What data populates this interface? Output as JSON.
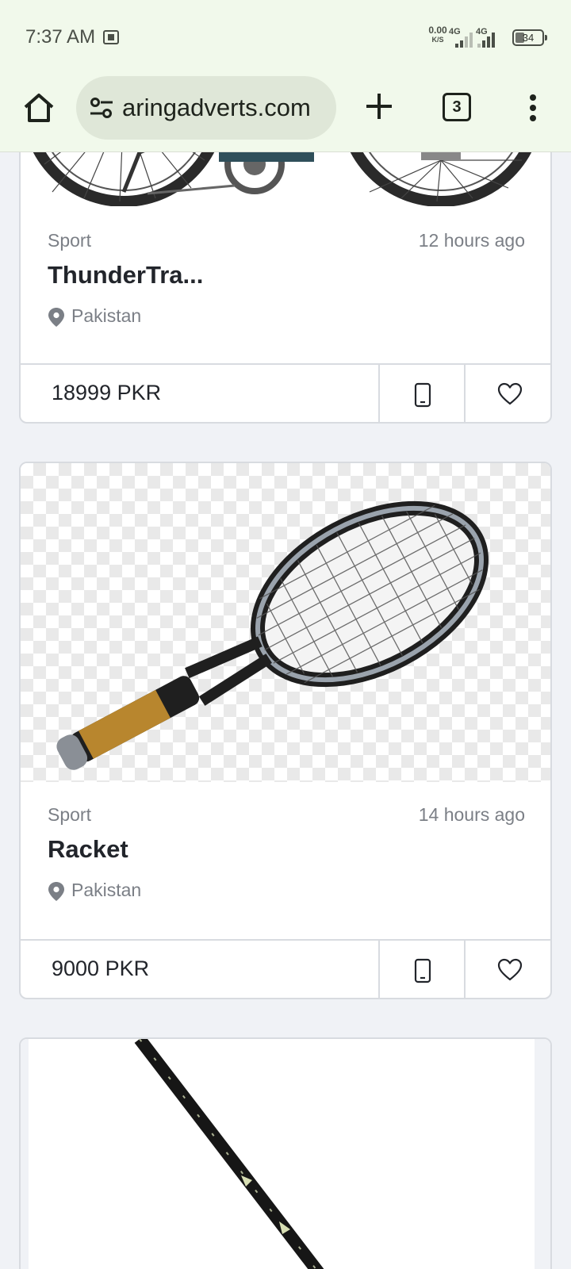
{
  "status_bar": {
    "time": "7:37 AM",
    "net_speed_value": "0.00",
    "net_speed_unit": "K/S",
    "sim1_label": "4G",
    "sim2_label": "4G",
    "battery_level": "34"
  },
  "browser": {
    "url": "aringadverts.com",
    "tab_count": "3",
    "icons": [
      "home-icon",
      "tune-icon",
      "plus-icon",
      "tabs-icon",
      "more-vert-icon"
    ]
  },
  "listings": [
    {
      "category": "Sport",
      "posted": "12 hours ago",
      "title": "ThunderTra...",
      "location": "Pakistan",
      "price": "18999 PKR",
      "image": "mountain bicycle (partially scrolled out of view)"
    },
    {
      "category": "Sport",
      "posted": "14 hours ago",
      "title": "Racket",
      "location": "Pakistan",
      "price": "9000 PKR",
      "image": "tennis racket on transparent checkerboard background"
    },
    {
      "image": "racket shaft close-up (partially visible)"
    }
  ],
  "colors": {
    "chrome_bg": "#f1f9eb",
    "url_pill_bg": "#dfe7d8",
    "page_bg": "#f0f2f6",
    "card_border": "#d8dbe0",
    "muted_text": "#7b7f86",
    "primary_text": "#22252b"
  }
}
